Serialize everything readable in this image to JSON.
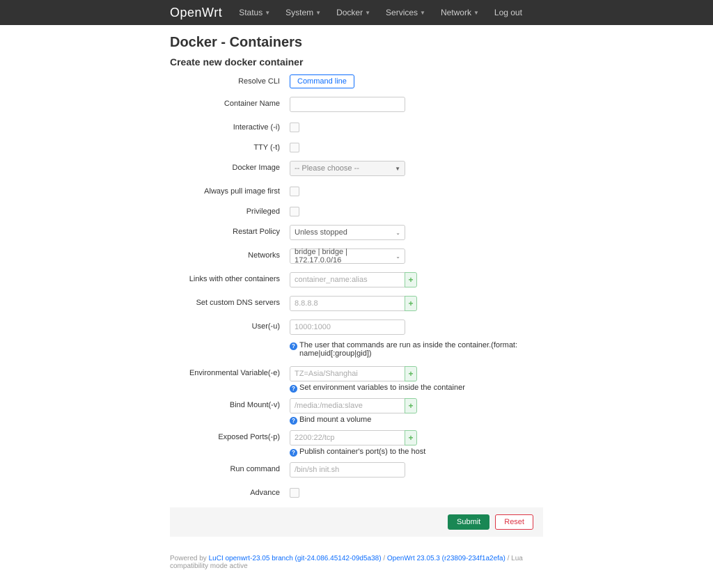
{
  "nav": {
    "brand": "OpenWrt",
    "items": [
      "Status",
      "System",
      "Docker",
      "Services",
      "Network"
    ],
    "logout": "Log out"
  },
  "page": {
    "title": "Docker - Containers",
    "subtitle": "Create new docker container"
  },
  "form": {
    "resolve_cli": {
      "label": "Resolve CLI",
      "button": "Command line"
    },
    "container_name": {
      "label": "Container Name"
    },
    "interactive": {
      "label": "Interactive (-i)"
    },
    "tty": {
      "label": "TTY (-t)"
    },
    "docker_image": {
      "label": "Docker Image",
      "placeholder": "-- Please choose --"
    },
    "always_pull": {
      "label": "Always pull image first"
    },
    "privileged": {
      "label": "Privileged"
    },
    "restart_policy": {
      "label": "Restart Policy",
      "value": "Unless stopped"
    },
    "networks": {
      "label": "Networks",
      "value": "bridge | bridge | 172.17.0.0/16"
    },
    "links": {
      "label": "Links with other containers",
      "placeholder": "container_name:alias"
    },
    "dns": {
      "label": "Set custom DNS servers",
      "placeholder": "8.8.8.8"
    },
    "user": {
      "label": "User(-u)",
      "placeholder": "1000:1000",
      "hint": "The user that commands are run as inside the container.(format: name|uid[:group|gid])"
    },
    "env": {
      "label": "Environmental Variable(-e)",
      "placeholder": "TZ=Asia/Shanghai",
      "hint": "Set environment variables to inside the container"
    },
    "bind": {
      "label": "Bind Mount(-v)",
      "placeholder": "/media:/media:slave",
      "hint": "Bind mount a volume"
    },
    "ports": {
      "label": "Exposed Ports(-p)",
      "placeholder": "2200:22/tcp",
      "hint": "Publish container's port(s) to the host"
    },
    "run_cmd": {
      "label": "Run command",
      "placeholder": "/bin/sh init.sh"
    },
    "advance": {
      "label": "Advance"
    }
  },
  "actions": {
    "submit": "Submit",
    "reset": "Reset"
  },
  "footer": {
    "powered": "Powered by ",
    "luci": "LuCI openwrt-23.05 branch (git-24.086.45142-09d5a38)",
    "sep": " / ",
    "owrt": "OpenWrt 23.05.3 (r23809-234f1a2efa)",
    "mode": " / Lua compatibility mode active"
  }
}
